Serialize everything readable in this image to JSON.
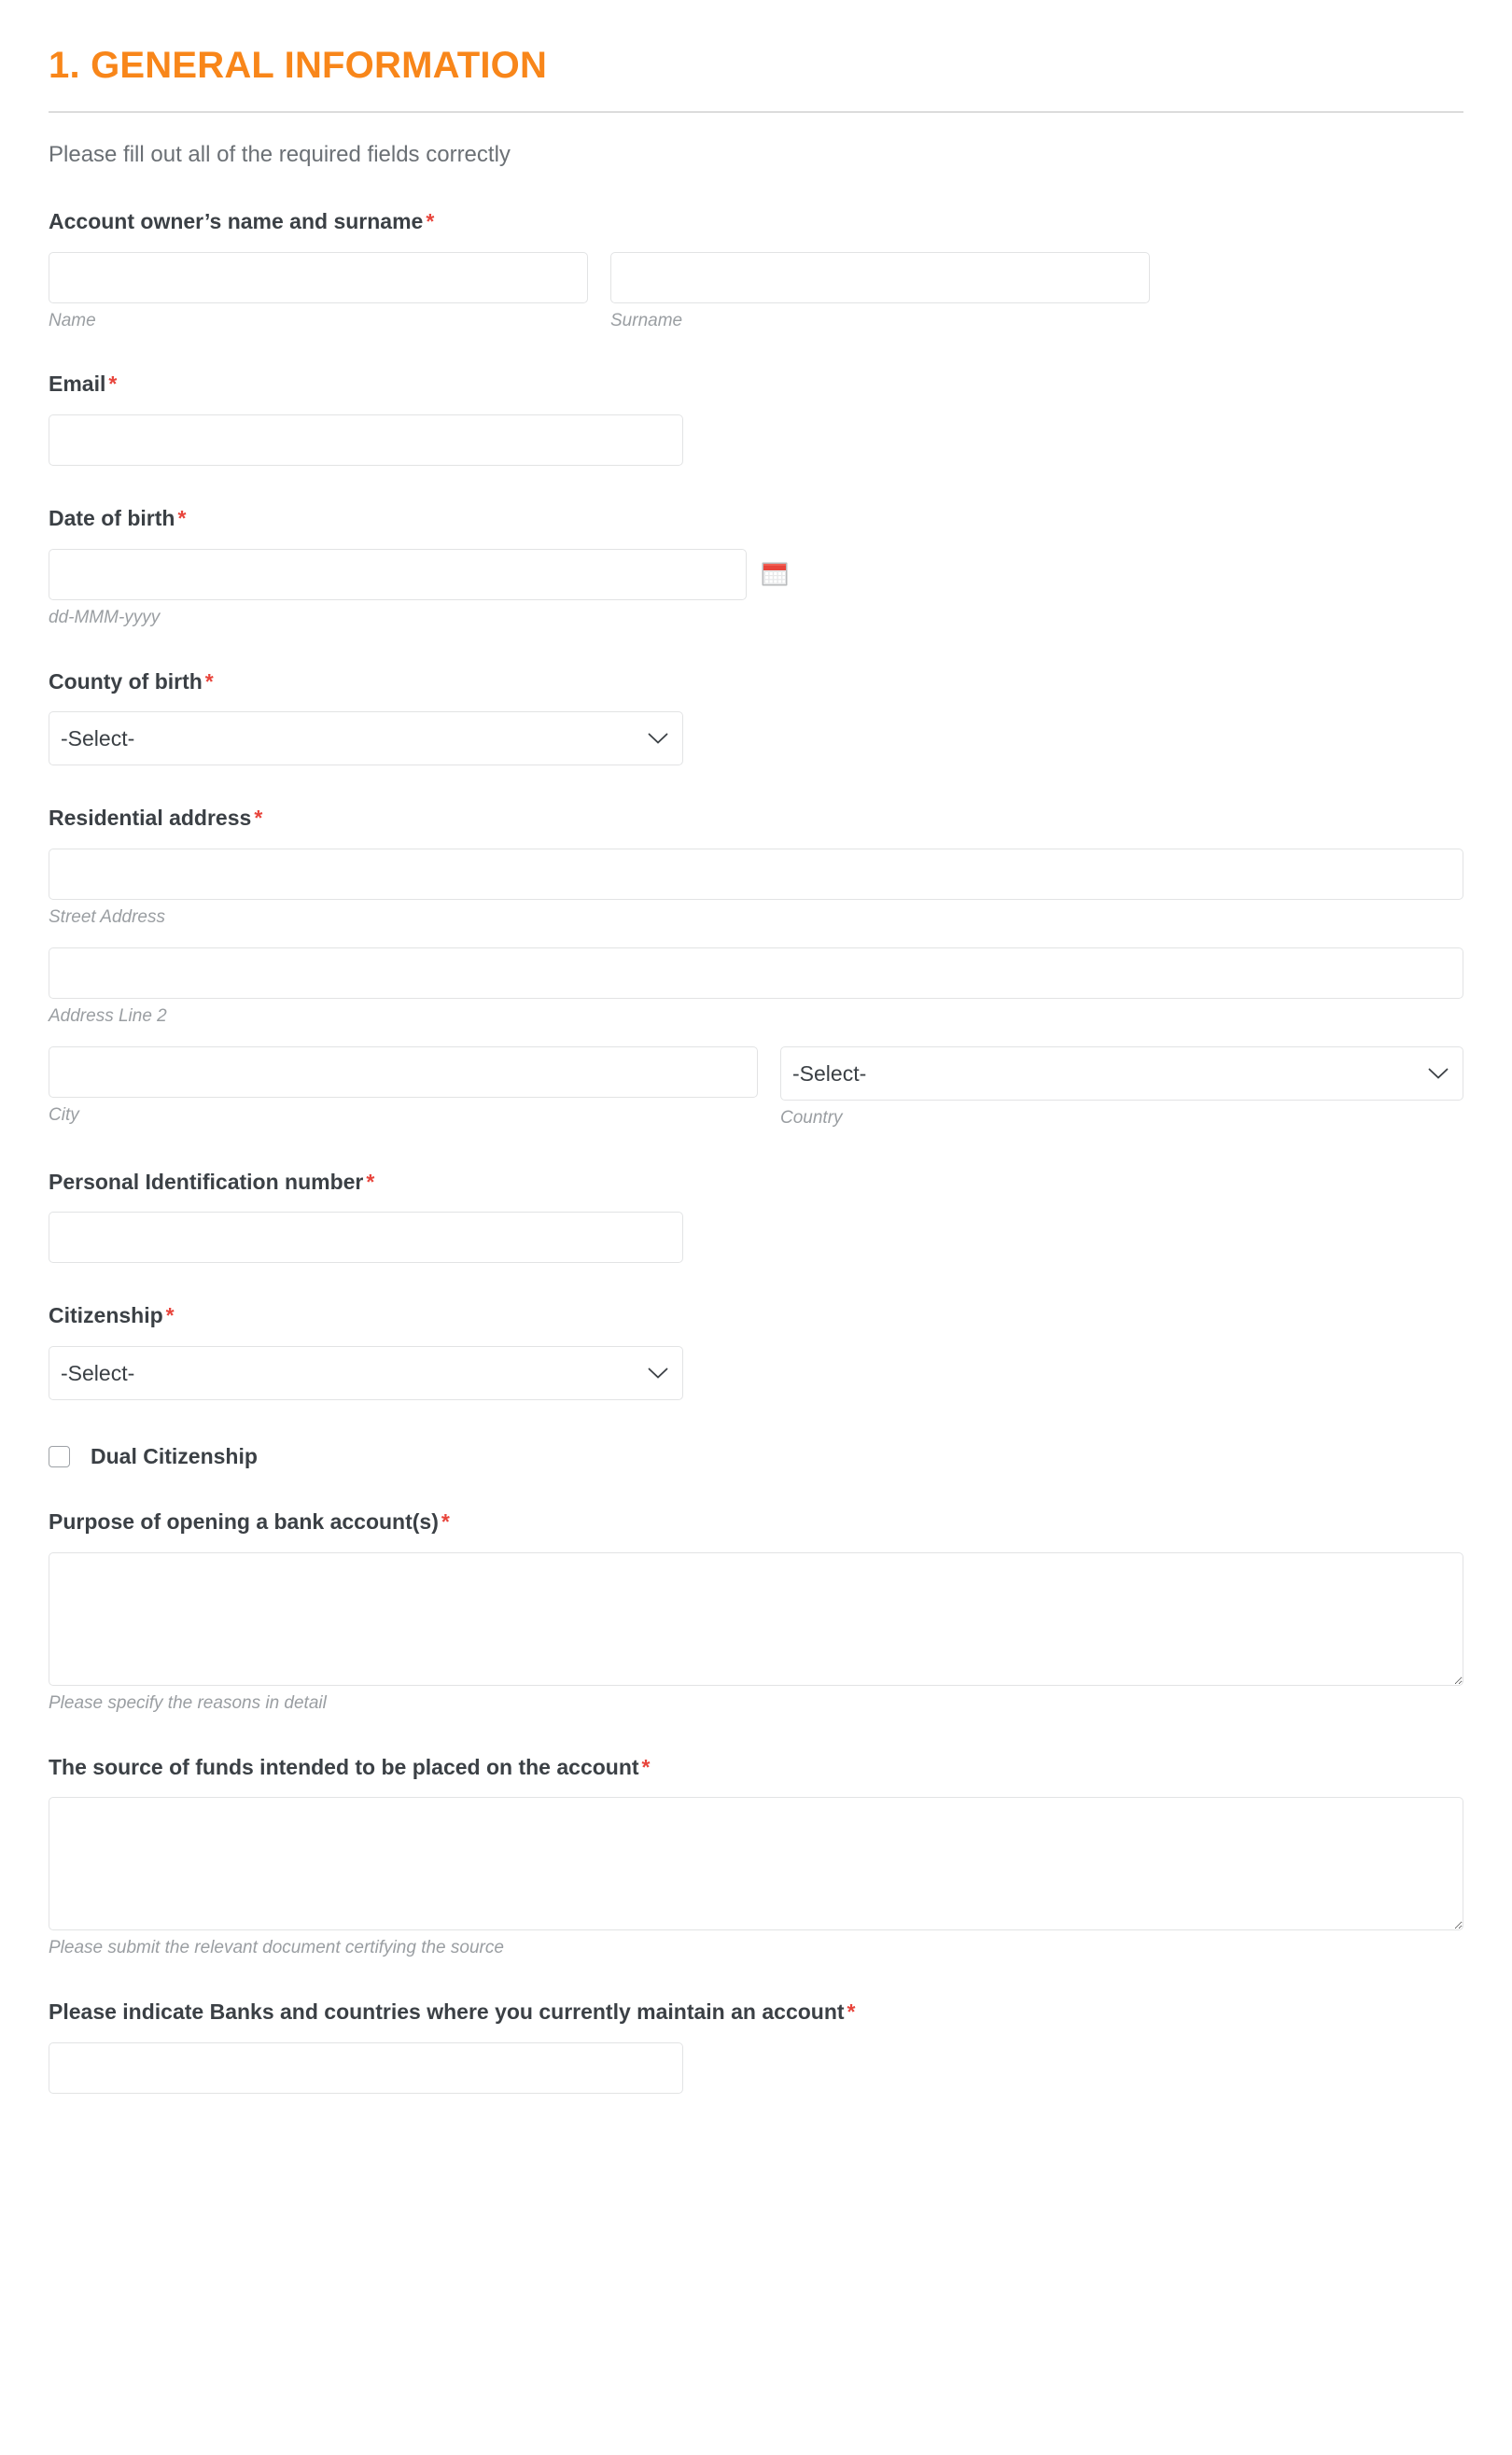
{
  "section": {
    "title": "1. GENERAL INFORMATION",
    "subtitle": "Please fill out all of the required fields correctly",
    "accent_color": "#f8861a",
    "required_marker": "*",
    "required_color": "#e8453c"
  },
  "fields": {
    "owner_name": {
      "label": "Account owner’s name and surname",
      "name_value": "",
      "name_placeholder": "",
      "name_sublabel": "Name",
      "surname_value": "",
      "surname_placeholder": "",
      "surname_sublabel": "Surname"
    },
    "email": {
      "label": "Email",
      "value": "",
      "placeholder": ""
    },
    "dob": {
      "label": "Date of birth",
      "value": "",
      "placeholder": "",
      "sublabel": "dd-MMM-yyyy",
      "icon": "calendar-icon"
    },
    "county_of_birth": {
      "label": "County of birth",
      "selected": "-Select-",
      "options": [
        "-Select-"
      ],
      "icon": "chevron-down-icon"
    },
    "residential_address": {
      "label": "Residential address",
      "street_value": "",
      "street_sublabel": "Street Address",
      "line2_value": "",
      "line2_sublabel": "Address Line 2",
      "city_value": "",
      "city_sublabel": "City",
      "country_selected": "-Select-",
      "country_options": [
        "-Select-"
      ],
      "country_sublabel": "Country"
    },
    "personal_id": {
      "label": "Personal Identification number",
      "value": "",
      "placeholder": ""
    },
    "citizenship": {
      "label": "Citizenship",
      "selected": "-Select-",
      "options": [
        "-Select-"
      ],
      "icon": "chevron-down-icon"
    },
    "dual_citizenship": {
      "label": "Dual Citizenship",
      "checked": false
    },
    "purpose": {
      "label": "Purpose of opening a bank account(s)",
      "value": "",
      "sublabel": "Please specify the reasons in detail"
    },
    "source_of_funds": {
      "label": "The source of funds intended to be placed on the account",
      "value": "",
      "sublabel": "Please submit the relevant document certifying the source"
    },
    "banks_and_countries": {
      "label": "Please indicate Banks and countries where you currently maintain an account",
      "value": "",
      "placeholder": ""
    }
  }
}
